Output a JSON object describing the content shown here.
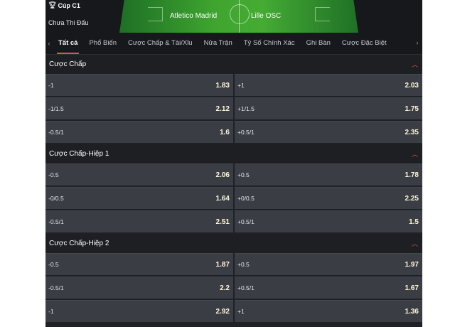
{
  "header": {
    "league": "Cúp C1",
    "status": "Chưa Thi Đấu",
    "home_team": "Atletico Madrid",
    "away_team": "Lille OSC"
  },
  "tabs": [
    {
      "label": "Tất cả",
      "active": true
    },
    {
      "label": "Phổ Biến",
      "active": false
    },
    {
      "label": "Cược Chấp & Tài/Xỉu",
      "active": false
    },
    {
      "label": "Nửa Trận",
      "active": false
    },
    {
      "label": "Tỷ Số Chính Xác",
      "active": false
    },
    {
      "label": "Ghi Bàn",
      "active": false
    },
    {
      "label": "Cược Đặc Biệt",
      "active": false
    }
  ],
  "sections": [
    {
      "title": "Cược Chấp",
      "rows": [
        {
          "left": {
            "label": "-1",
            "odds": "1.83"
          },
          "right": {
            "label": "+1",
            "odds": "2.03"
          }
        },
        {
          "left": {
            "label": "-1/1.5",
            "odds": "2.12"
          },
          "right": {
            "label": "+1/1.5",
            "odds": "1.75"
          }
        },
        {
          "left": {
            "label": "-0.5/1",
            "odds": "1.6"
          },
          "right": {
            "label": "+0.5/1",
            "odds": "2.35"
          }
        }
      ]
    },
    {
      "title": "Cược Chấp-Hiệp 1",
      "rows": [
        {
          "left": {
            "label": "-0.5",
            "odds": "2.06"
          },
          "right": {
            "label": "+0.5",
            "odds": "1.78"
          }
        },
        {
          "left": {
            "label": "-0/0.5",
            "odds": "1.64"
          },
          "right": {
            "label": "+0/0.5",
            "odds": "2.25"
          }
        },
        {
          "left": {
            "label": "-0.5/1",
            "odds": "2.51"
          },
          "right": {
            "label": "+0.5/1",
            "odds": "1.5"
          }
        }
      ]
    },
    {
      "title": "Cược Chấp-Hiệp 2",
      "rows": [
        {
          "left": {
            "label": "-0.5",
            "odds": "1.87"
          },
          "right": {
            "label": "+0.5",
            "odds": "1.97"
          }
        },
        {
          "left": {
            "label": "-0.5/1",
            "odds": "2.2"
          },
          "right": {
            "label": "+0.5/1",
            "odds": "1.67"
          }
        },
        {
          "left": {
            "label": "-1",
            "odds": "2.92"
          },
          "right": {
            "label": "+1",
            "odds": "1.36"
          }
        }
      ]
    }
  ],
  "icons": {
    "trophy": "trophy-icon",
    "tab_left": "chevron-left-icon",
    "tab_right": "chevron-right-icon",
    "collapse": "chevron-up-icon"
  },
  "colors": {
    "accent": "#e2524a",
    "cell_bg": "#3a3d44",
    "page_bg": "#1f2126"
  }
}
